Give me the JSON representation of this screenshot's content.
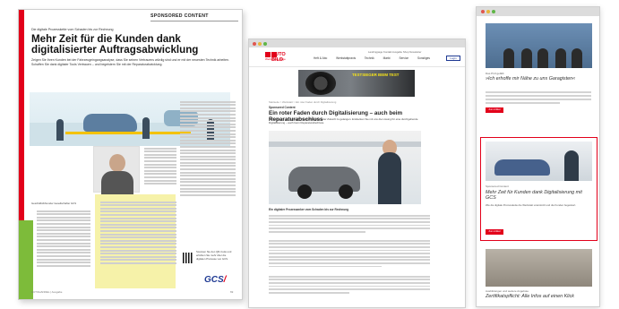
{
  "magazine": {
    "tagline": "Die digitale Prozesskette vom Schaden bis zur Rechnung",
    "section": "SPONSORED CONTENT",
    "title": "Mehr Zeit für die Kunden dank digitalisierter Auftragsabwicklung",
    "lead": "Zeigen Sie Ihren Kunden bei der Fahrzeugeingangsanalyse, dass Sie seinen Vertrauens würdig sind und er mit der neuesten Technik arbeiten. Schaffen Sie dank digitaler Tools Vertrauen – und begeistern Sie mit der Reparaturabwicklung.",
    "caption": "Geschäftsführender Gesellschafter GCS",
    "qr_text": "Scannen Sie den QR-Code und erfahren Sie mehr über die digitalen Prozesse von GCS.",
    "brand_main": "GCS",
    "footer": "AUTOHANDEL | Ausgabe",
    "page_number": "69"
  },
  "browser": {
    "logo_name": "AUTO BILD",
    "logo_sub": "Werkstattanfrage",
    "top_links": "Landingpage  Kontakt  Ausgabe  Shop  Newsletter",
    "nav": [
      "Heft & Abo",
      "Werkstattpraxis",
      "Technik",
      "Markt",
      "Service",
      "Sonstiges"
    ],
    "login_label": "Login",
    "banner_text": "TESTSIEGER BEIM TEST",
    "breadcrumb": "Startseite > Werkstatt > Ein roter Faden durch Digitalisierung",
    "kicker": "Sponsored Content",
    "article_title": "Ein roter Faden durch Digitalisierung – auch beim Reparaturabschluss",
    "article_lead": "Sehen Sie zu, mit der GCS zum Kundendienst der Zukunft zu gelangen. Entdecken Sie mit uns die Lösung für eine durchgehende Digitalisierung – auch beim Reparaturabschluss.",
    "subhead": "Ein digitaler Prozessanker vom Schaden bis zur Rechnung"
  },
  "mobile": {
    "teaser1_category": "Das Prüf gefällt",
    "teaser1_title": "»Ich erhoffe mir Nähe zu uns Garagisten«",
    "teaser1_button": "Zum Artikel",
    "teaser2_category": "Sponsored Content",
    "teaser2_title": "Mehr Zeit für Kunden dank Digitalisierung mit GCS",
    "teaser2_text": "Wie die digitale Prozesskette die Werkstatt unterstützt und die Kunden begeistert.",
    "teaser2_button": "Zum Artikel",
    "teaser3_category": "Ausbildungen und weitere Angebote",
    "teaser3_title": "Zertifikatspflicht: Alle Infos auf einen Klick"
  },
  "colors": {
    "brand_red": "#e2001a",
    "brand_blue": "#1f3a93"
  }
}
